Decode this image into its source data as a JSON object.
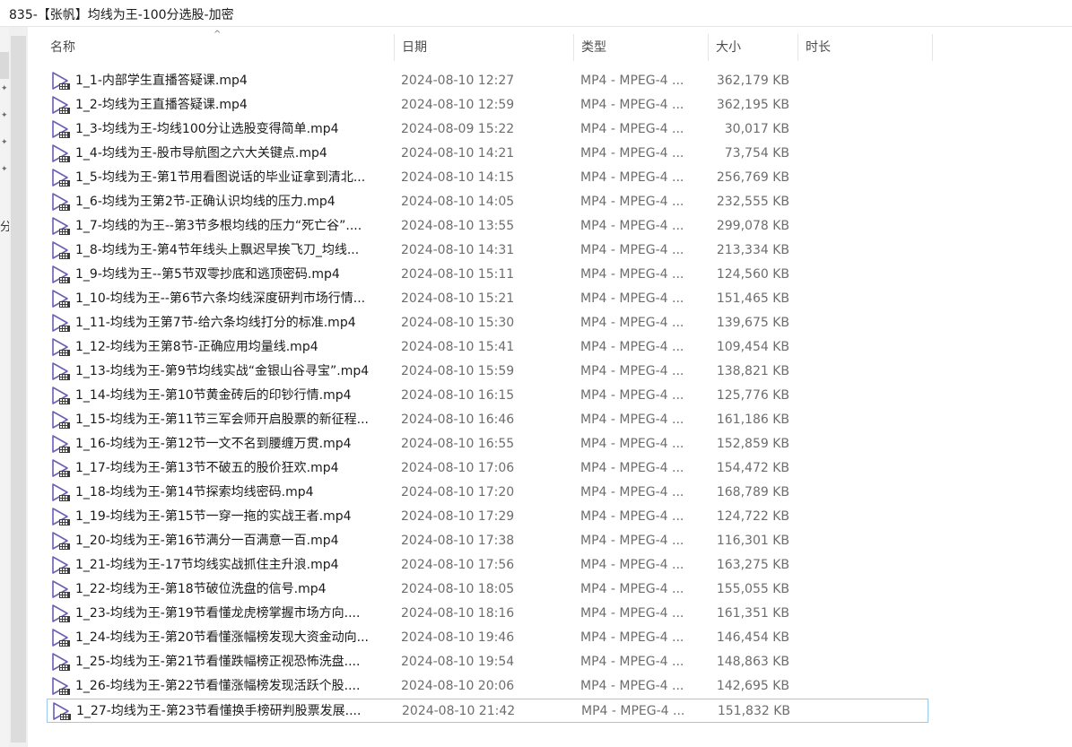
{
  "window": {
    "title": "835-【张帆】均线为王-100分选股-加密"
  },
  "navpane": {
    "cut_label": "分"
  },
  "columns": {
    "name": "名称",
    "date": "日期",
    "type": "类型",
    "size": "大小",
    "duration": "时长"
  },
  "files": [
    {
      "name": "1_1-内部学生直播答疑课.mp4",
      "date": "2024-08-10 12:27",
      "type": "MP4 - MPEG-4 ...",
      "size": "362,179 KB"
    },
    {
      "name": "1_2-均线为王直播答疑课.mp4",
      "date": "2024-08-10 12:59",
      "type": "MP4 - MPEG-4 ...",
      "size": "362,195 KB"
    },
    {
      "name": "1_3-均线为王-均线100分让选股变得简单.mp4",
      "date": "2024-08-09 15:22",
      "type": "MP4 - MPEG-4 ...",
      "size": "30,017 KB"
    },
    {
      "name": "1_4-均线为王-股市导航图之六大关键点.mp4",
      "date": "2024-08-10 14:21",
      "type": "MP4 - MPEG-4 ...",
      "size": "73,754 KB"
    },
    {
      "name": "1_5-均线为王-第1节用看图说话的毕业证拿到清北...",
      "date": "2024-08-10 14:15",
      "type": "MP4 - MPEG-4 ...",
      "size": "256,769 KB"
    },
    {
      "name": "1_6-均线为王第2节-正确认识均线的压力.mp4",
      "date": "2024-08-10 14:05",
      "type": "MP4 - MPEG-4 ...",
      "size": "232,555 KB"
    },
    {
      "name": "1_7-均线的为王--第3节多根均线的压力“死亡谷”....",
      "date": "2024-08-10 13:55",
      "type": "MP4 - MPEG-4 ...",
      "size": "299,078 KB"
    },
    {
      "name": "1_8-均线为王-第4节年线头上飘迟早挨飞刀_均线...",
      "date": "2024-08-10 14:31",
      "type": "MP4 - MPEG-4 ...",
      "size": "213,334 KB"
    },
    {
      "name": "1_9-均线为王--第5节双零抄底和逃顶密码.mp4",
      "date": "2024-08-10 15:11",
      "type": "MP4 - MPEG-4 ...",
      "size": "124,560 KB"
    },
    {
      "name": "1_10-均线为王--第6节六条均线深度研判市场行情...",
      "date": "2024-08-10 15:21",
      "type": "MP4 - MPEG-4 ...",
      "size": "151,465 KB"
    },
    {
      "name": "1_11-均线为王第7节-给六条均线打分的标准.mp4",
      "date": "2024-08-10 15:30",
      "type": "MP4 - MPEG-4 ...",
      "size": "139,675 KB"
    },
    {
      "name": "1_12-均线为王第8节-正确应用均量线.mp4",
      "date": "2024-08-10 15:41",
      "type": "MP4 - MPEG-4 ...",
      "size": "109,454 KB"
    },
    {
      "name": "1_13-均线为王-第9节均线实战“金银山谷寻宝”.mp4",
      "date": "2024-08-10 15:59",
      "type": "MP4 - MPEG-4 ...",
      "size": "138,821 KB"
    },
    {
      "name": "1_14-均线为王-第10节黄金砖后的印钞行情.mp4",
      "date": "2024-08-10 16:15",
      "type": "MP4 - MPEG-4 ...",
      "size": "125,776 KB"
    },
    {
      "name": "1_15-均线为王-第11节三军会师开启股票的新征程...",
      "date": "2024-08-10 16:46",
      "type": "MP4 - MPEG-4 ...",
      "size": "161,186 KB"
    },
    {
      "name": "1_16-均线为王-第12节一文不名到腰缠万贯.mp4",
      "date": "2024-08-10 16:55",
      "type": "MP4 - MPEG-4 ...",
      "size": "152,859 KB"
    },
    {
      "name": "1_17-均线为王-第13节不破五的股价狂欢.mp4",
      "date": "2024-08-10 17:06",
      "type": "MP4 - MPEG-4 ...",
      "size": "154,472 KB"
    },
    {
      "name": "1_18-均线为王-第14节探索均线密码.mp4",
      "date": "2024-08-10 17:20",
      "type": "MP4 - MPEG-4 ...",
      "size": "168,789 KB"
    },
    {
      "name": "1_19-均线为王-第15节一穿一拖的实战王者.mp4",
      "date": "2024-08-10 17:29",
      "type": "MP4 - MPEG-4 ...",
      "size": "124,722 KB"
    },
    {
      "name": "1_20-均线为王-第16节满分一百满意一百.mp4",
      "date": "2024-08-10 17:38",
      "type": "MP4 - MPEG-4 ...",
      "size": "116,301 KB"
    },
    {
      "name": "1_21-均线为王-17节均线实战抓住主升浪.mp4",
      "date": "2024-08-10 17:56",
      "type": "MP4 - MPEG-4 ...",
      "size": "163,275 KB"
    },
    {
      "name": "1_22-均线为王-第18节破位洗盘的信号.mp4",
      "date": "2024-08-10 18:05",
      "type": "MP4 - MPEG-4 ...",
      "size": "155,055 KB"
    },
    {
      "name": "1_23-均线为王-第19节看懂龙虎榜掌握市场方向....",
      "date": "2024-08-10 18:16",
      "type": "MP4 - MPEG-4 ...",
      "size": "161,351 KB"
    },
    {
      "name": "1_24-均线为王-第20节看懂涨幅榜发现大资金动向...",
      "date": "2024-08-10 19:46",
      "type": "MP4 - MPEG-4 ...",
      "size": "146,454 KB"
    },
    {
      "name": "1_25-均线为王-第21节看懂跌幅榜正视恐怖洗盘....",
      "date": "2024-08-10 19:54",
      "type": "MP4 - MPEG-4 ...",
      "size": "148,863 KB"
    },
    {
      "name": "1_26-均线为王-第22节看懂涨幅榜发现活跃个股....",
      "date": "2024-08-10 20:06",
      "type": "MP4 - MPEG-4 ...",
      "size": "142,695 KB"
    },
    {
      "name": "1_27-均线为王-第23节看懂换手榜研判股票发展....",
      "date": "2024-08-10 21:42",
      "type": "MP4 - MPEG-4 ...",
      "size": "151,832 KB"
    }
  ],
  "selected_index": 26,
  "colors": {
    "icon_purple": "#6b5fb5",
    "selection_border": "#99c9ef"
  }
}
